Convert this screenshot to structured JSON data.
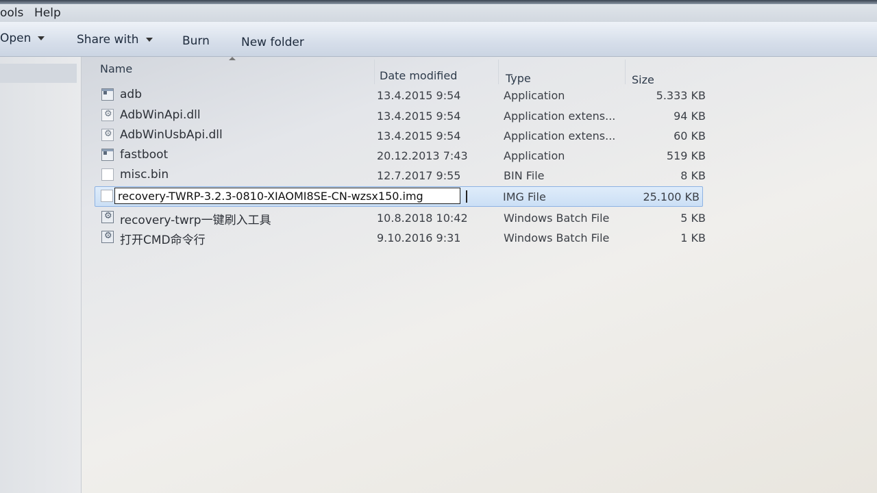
{
  "menubar": {
    "tools": "ools",
    "help": "Help"
  },
  "toolbar": {
    "open": "Open",
    "share_with": "Share with",
    "burn": "Burn",
    "new_folder": "New folder"
  },
  "columns": {
    "name": "Name",
    "date_modified": "Date modified",
    "type": "Type",
    "size": "Size"
  },
  "files": [
    {
      "name": "adb",
      "date": "13.4.2015 9:54",
      "type": "Application",
      "size": "5.333 KB",
      "icon": "application-icon"
    },
    {
      "name": "AdbWinApi.dll",
      "date": "13.4.2015 9:54",
      "type": "Application extens...",
      "size": "94 KB",
      "icon": "dll-icon"
    },
    {
      "name": "AdbWinUsbApi.dll",
      "date": "13.4.2015 9:54",
      "type": "Application extens...",
      "size": "60 KB",
      "icon": "dll-icon"
    },
    {
      "name": "fastboot",
      "date": "20.12.2013 7:43",
      "type": "Application",
      "size": "519 KB",
      "icon": "application-icon"
    },
    {
      "name": "misc.bin",
      "date": "12.7.2017 9:55",
      "type": "BIN File",
      "size": "8 KB",
      "icon": "blank-file-icon"
    },
    {
      "name": "recovery-TWRP-3.2.3-0810-XIAOMI8SE-CN-wzsx150.img",
      "date": "",
      "type": "IMG File",
      "size": "25.100 KB",
      "icon": "blank-file-icon"
    },
    {
      "name": "recovery-twrp一键刷入工具",
      "date": "10.8.2018 10:42",
      "type": "Windows Batch File",
      "size": "5 KB",
      "icon": "batch-file-icon"
    },
    {
      "name": "打开CMD命令行",
      "date": "9.10.2016 9:31",
      "type": "Windows Batch File",
      "size": "1 KB",
      "icon": "batch-file-icon"
    }
  ]
}
